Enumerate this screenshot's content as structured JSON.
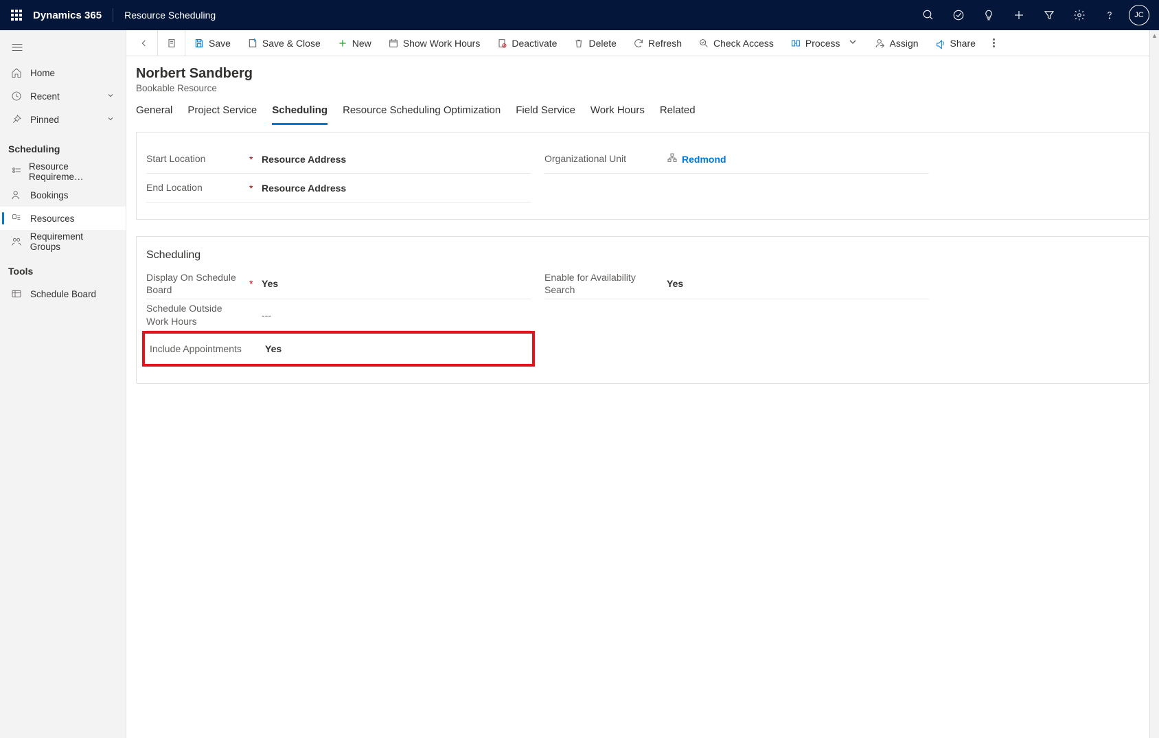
{
  "top": {
    "brand": "Dynamics 365",
    "module": "Resource Scheduling",
    "avatar": "JC"
  },
  "left": {
    "items_primary": [
      {
        "label": "Home"
      },
      {
        "label": "Recent"
      },
      {
        "label": "Pinned"
      }
    ],
    "group_scheduling": "Scheduling",
    "items_scheduling": [
      {
        "label": "Resource Requireme…"
      },
      {
        "label": "Bookings"
      },
      {
        "label": "Resources"
      },
      {
        "label": "Requirement Groups"
      }
    ],
    "group_tools": "Tools",
    "items_tools": [
      {
        "label": "Schedule Board"
      }
    ]
  },
  "commands": {
    "save": "Save",
    "save_close": "Save & Close",
    "new": "New",
    "show_hours": "Show Work Hours",
    "deactivate": "Deactivate",
    "delete": "Delete",
    "refresh": "Refresh",
    "check_access": "Check Access",
    "process": "Process",
    "assign": "Assign",
    "share": "Share"
  },
  "record": {
    "title": "Norbert Sandberg",
    "subtitle": "Bookable Resource"
  },
  "tabs": [
    "General",
    "Project Service",
    "Scheduling",
    "Resource Scheduling Optimization",
    "Field Service",
    "Work Hours",
    "Related"
  ],
  "section1": {
    "start_loc_label": "Start Location",
    "start_loc_value": "Resource Address",
    "end_loc_label": "End Location",
    "end_loc_value": "Resource Address",
    "org_unit_label": "Organizational Unit",
    "org_unit_value": "Redmond"
  },
  "section2": {
    "title": "Scheduling",
    "display_board_label": "Display On Schedule Board",
    "display_board_value": "Yes",
    "outside_label": "Schedule Outside Work Hours",
    "outside_value": "---",
    "include_label": "Include Appointments",
    "include_value": "Yes",
    "enable_label": "Enable for Availability Search",
    "enable_value": "Yes"
  }
}
